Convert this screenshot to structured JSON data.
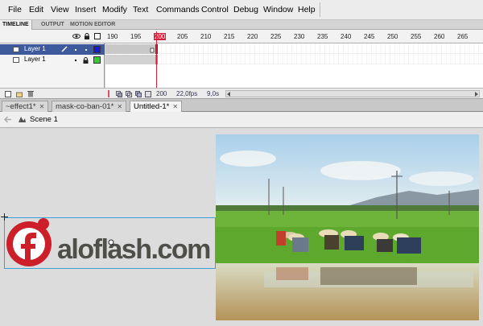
{
  "menu": [
    "File",
    "Edit",
    "View",
    "Insert",
    "Modify",
    "Text",
    "Commands",
    "Control",
    "Debug",
    "Window",
    "Help"
  ],
  "panel_tabs": [
    "TIMELINE",
    "OUTPUT",
    "MOTION EDITOR"
  ],
  "ruler": [
    "190",
    "195",
    "200",
    "205",
    "210",
    "215",
    "220",
    "225",
    "230",
    "235",
    "240",
    "245",
    "250",
    "255",
    "260",
    "265"
  ],
  "layers": [
    {
      "name": "Layer 1",
      "color": "#1a1ad0",
      "selected": true
    },
    {
      "name": "Layer 1",
      "color": "#33cc33",
      "selected": false
    }
  ],
  "status": {
    "frame": "200",
    "fps": "22,0",
    "fps_unit": "fps",
    "time": "9,0s"
  },
  "doc_tabs": [
    {
      "label": "~effect1*",
      "active": false
    },
    {
      "label": "mask-co-ban-01*",
      "active": false
    },
    {
      "label": "Untitled-1*",
      "active": true
    }
  ],
  "scene": "Scene 1",
  "logo": {
    "text": "aloflash.com",
    "letter": "f",
    "color": "#cc1f2a"
  },
  "colors": {
    "playhead": "#d8203a",
    "selection": "#3d5b9c"
  }
}
